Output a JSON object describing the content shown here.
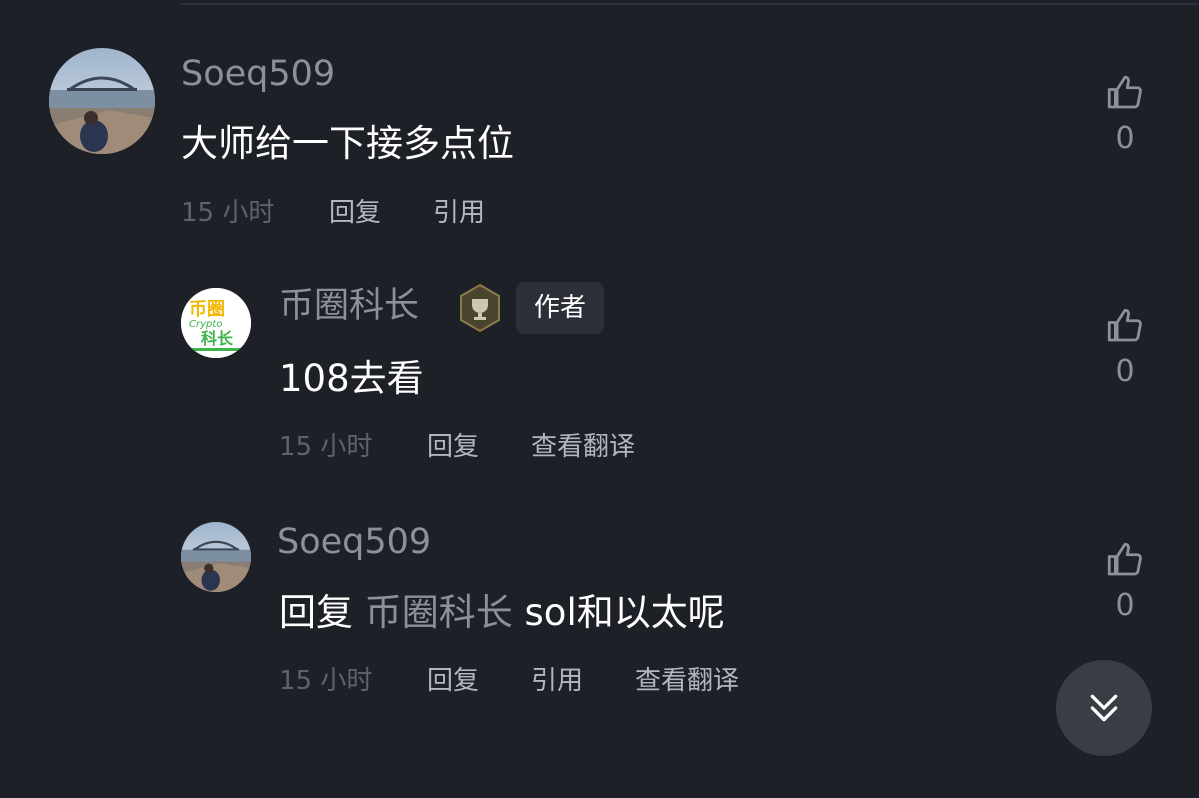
{
  "comments": [
    {
      "username": "Soeq509",
      "text": "大师给一下接多点位",
      "time": "15 小时",
      "actions": [
        "回复",
        "引用"
      ],
      "likes": "0"
    },
    {
      "username": "币圈科长",
      "badge": "作者",
      "avatar_text_top": "币圈",
      "avatar_text_mid": "Crypto",
      "avatar_text_bottom": "科长",
      "text": "108去看",
      "time": "15 小时",
      "actions": [
        "回复",
        "查看翻译"
      ],
      "likes": "0"
    },
    {
      "username": "Soeq509",
      "reply_prefix": "回复",
      "reply_mention": "币圈科长",
      "text": "sol和以太呢",
      "time": "15 小时",
      "actions": [
        "回复",
        "引用",
        "查看翻译"
      ],
      "likes": "0"
    }
  ],
  "colors": {
    "background": "#1e2027",
    "muted_text": "#8e9098",
    "badge_bg": "#2c2f37",
    "scroll_button_bg": "#3a3d45"
  },
  "icons": {
    "like": "thumbs-up-icon",
    "trophy": "trophy-badge-icon",
    "scroll": "double-chevron-down-icon"
  }
}
